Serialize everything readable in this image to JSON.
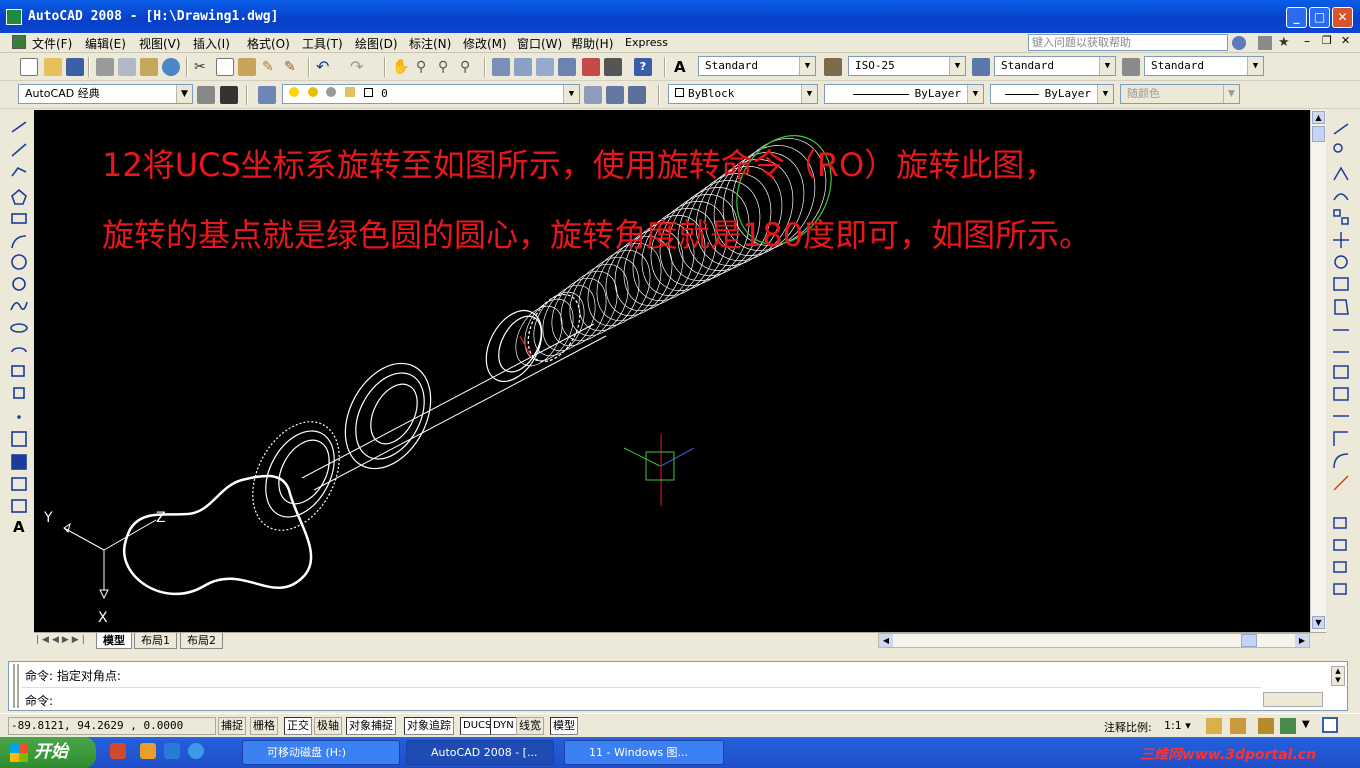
{
  "window": {
    "title": "AutoCAD 2008 - [H:\\Drawing1.dwg]"
  },
  "menu": [
    "文件(F)",
    "编辑(E)",
    "视图(V)",
    "插入(I)",
    "格式(O)",
    "工具(T)",
    "绘图(D)",
    "标注(N)",
    "修改(M)",
    "窗口(W)",
    "帮助(H)",
    "Express"
  ],
  "help_search": {
    "placeholder": "键入问题以获取帮助"
  },
  "toolbar_styles": {
    "text_style": "Standard",
    "dim_style": "ISO-25",
    "table_style": "Standard",
    "mleader_style": "Standard"
  },
  "toolbar_props": {
    "workspace": "AutoCAD 经典",
    "layer": "0",
    "color": "ByBlock",
    "linetype": "ByLayer",
    "lineweight": "ByLayer",
    "plotstyle": "随颜色"
  },
  "annotation": {
    "line1": "12将UCS坐标系旋转至如图所示，使用旋转命令（RO）旋转此图，",
    "line2": "旋转的基点就是绿色圆的圆心，旋转角度就是180度即可，如图所示。"
  },
  "ucs_labels": {
    "x": "X",
    "y": "Y",
    "z": "Z"
  },
  "layout_tabs": [
    "模型",
    "布局1",
    "布局2"
  ],
  "command": {
    "line1": "命令: 指定对角点:",
    "line2": "命令:"
  },
  "status": {
    "coords": "-89.8121,  94.2629 , 0.0000",
    "toggles": [
      "捕捉",
      "栅格",
      "正交",
      "极轴",
      "对象捕捉",
      "对象追踪",
      "DUCS",
      "DYN",
      "线宽",
      "模型"
    ],
    "anno_scale_label": "注释比例:",
    "anno_scale_value": "1:1"
  },
  "taskbar": {
    "start": "开始",
    "tasks": [
      "可移动磁盘 (H:)",
      "AutoCAD 2008 - [...",
      "11 - Windows 图..."
    ],
    "watermark": "三维网www.3dportal.cn"
  },
  "colors": {
    "annotation": "#e8171b",
    "canvas_bg": "#000000",
    "titlebar": "#0a46d0"
  }
}
